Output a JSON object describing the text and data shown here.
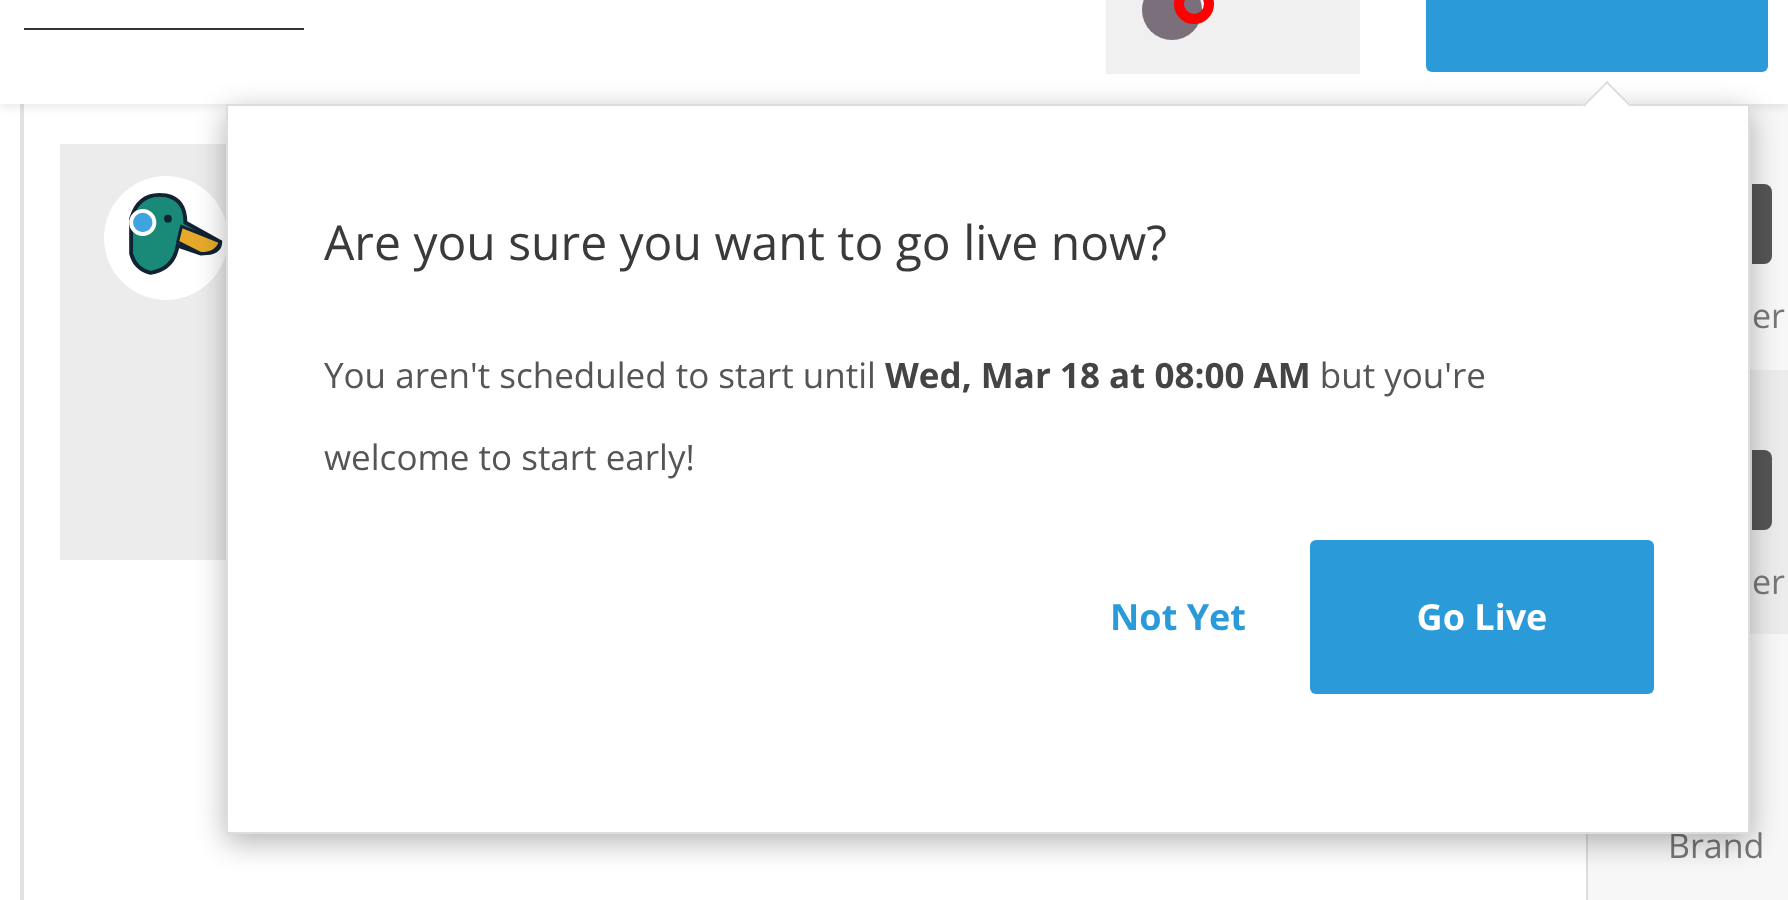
{
  "popover": {
    "title": "Are you sure you want to go live now?",
    "message": "You aren't scheduled to start until **Wed, Mar 18 at 08:00 AM** but you're welcome to start early!",
    "buttons": [
      {
        "label": "Not Yet",
        "kind": "link"
      },
      {
        "label": "Go Live",
        "kind": "primary"
      }
    ]
  },
  "sidebar": {
    "items": [
      {
        "label": "er"
      },
      {
        "label": "er"
      },
      {
        "label": "Brand"
      }
    ]
  }
}
